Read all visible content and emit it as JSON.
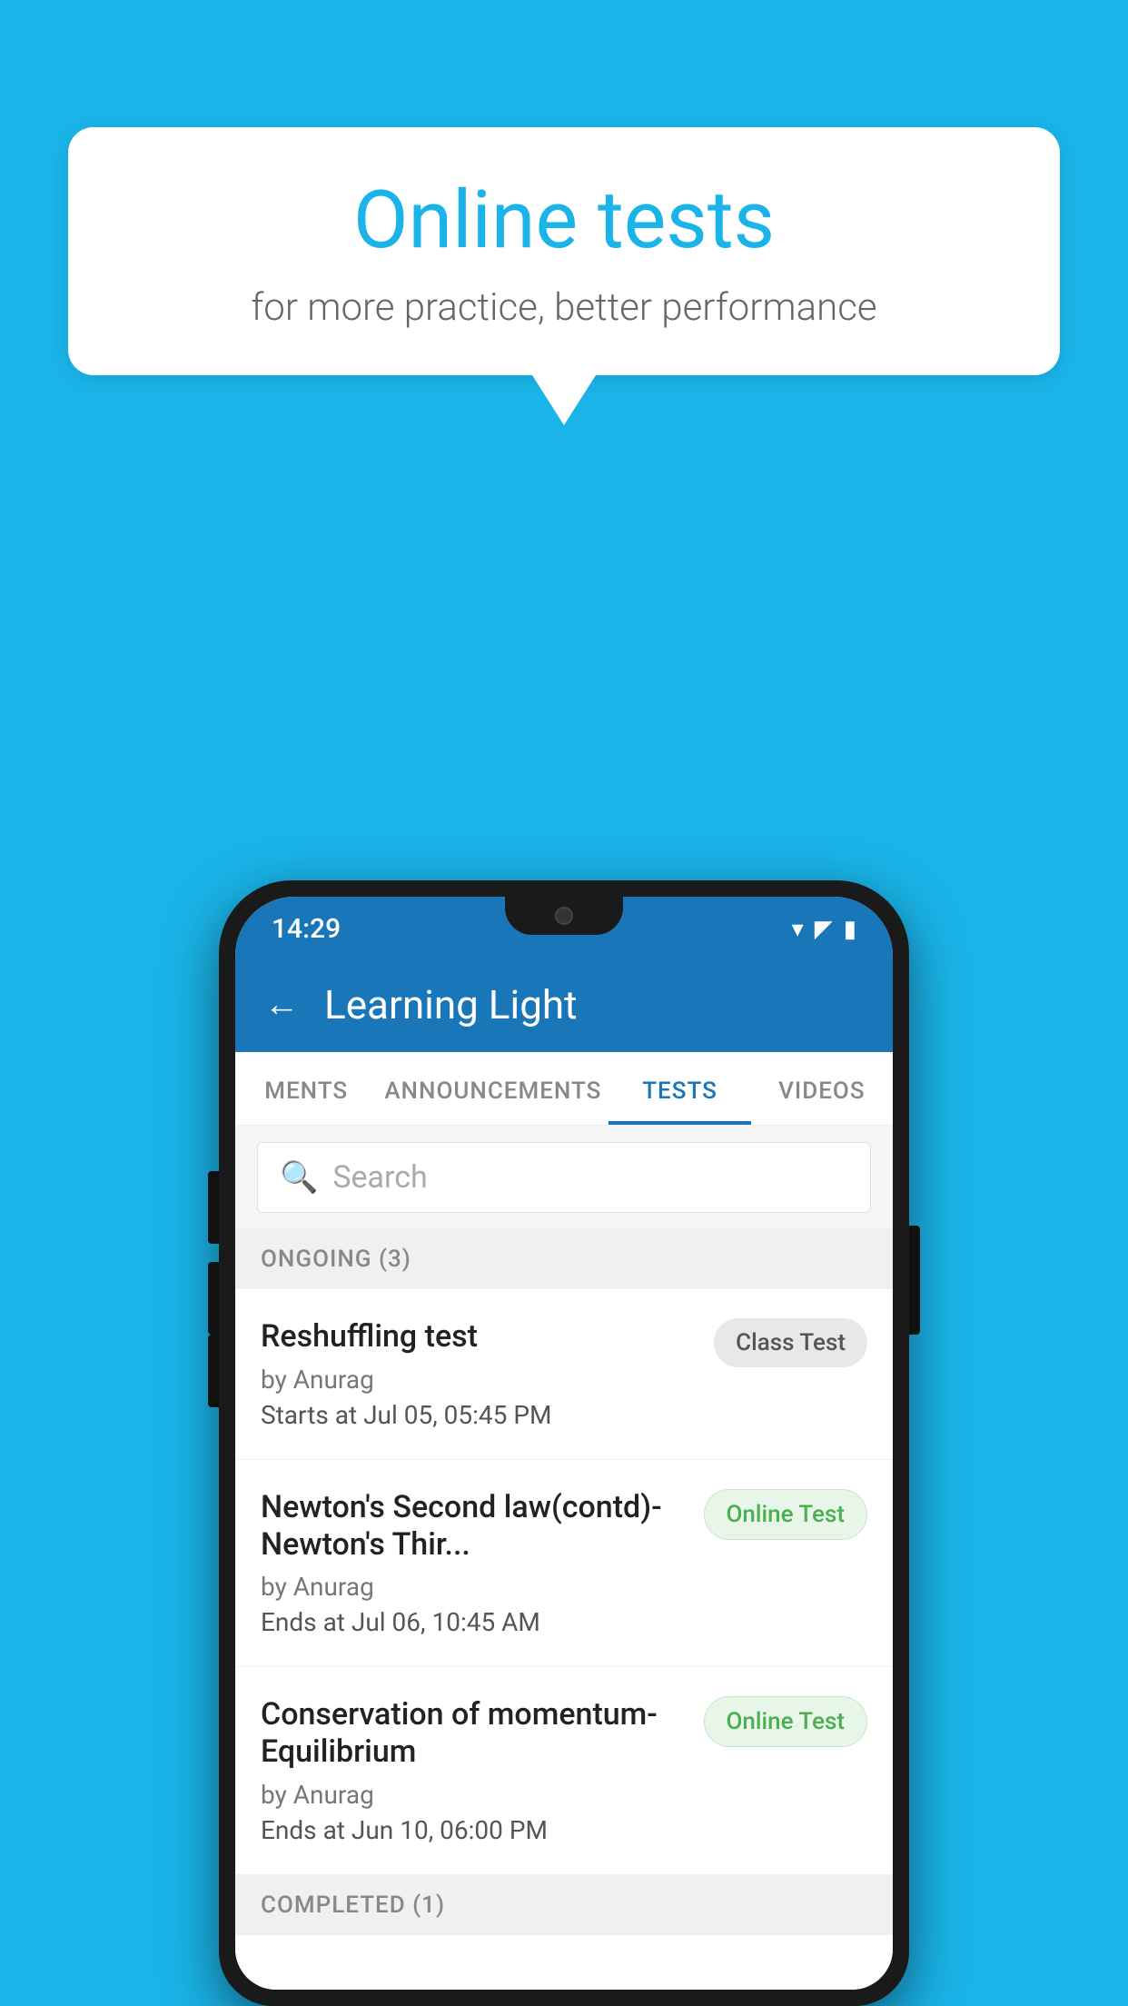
{
  "background": {
    "color": "#1ab4e8"
  },
  "speech_bubble": {
    "title": "Online tests",
    "subtitle": "for more practice, better performance"
  },
  "phone": {
    "status_bar": {
      "time": "14:29",
      "icons": [
        "wifi",
        "signal",
        "battery"
      ]
    },
    "app_bar": {
      "title": "Learning Light",
      "back_label": "←"
    },
    "tabs": [
      {
        "label": "MENTS",
        "active": false
      },
      {
        "label": "ANNOUNCEMENTS",
        "active": false
      },
      {
        "label": "TESTS",
        "active": true
      },
      {
        "label": "VIDEOS",
        "active": false
      }
    ],
    "search": {
      "placeholder": "Search"
    },
    "ongoing_section": {
      "label": "ONGOING (3)"
    },
    "tests": [
      {
        "name": "Reshuffling test",
        "author": "by Anurag",
        "date_label": "Starts at",
        "date_value": "Jul 05, 05:45 PM",
        "badge": "Class Test",
        "badge_type": "class"
      },
      {
        "name": "Newton's Second law(contd)-Newton's Thir...",
        "author": "by Anurag",
        "date_label": "Ends at",
        "date_value": "Jul 06, 10:45 AM",
        "badge": "Online Test",
        "badge_type": "online"
      },
      {
        "name": "Conservation of momentum-Equilibrium",
        "author": "by Anurag",
        "date_label": "Ends at",
        "date_value": "Jun 10, 06:00 PM",
        "badge": "Online Test",
        "badge_type": "online"
      }
    ],
    "completed_section": {
      "label": "COMPLETED (1)"
    }
  }
}
